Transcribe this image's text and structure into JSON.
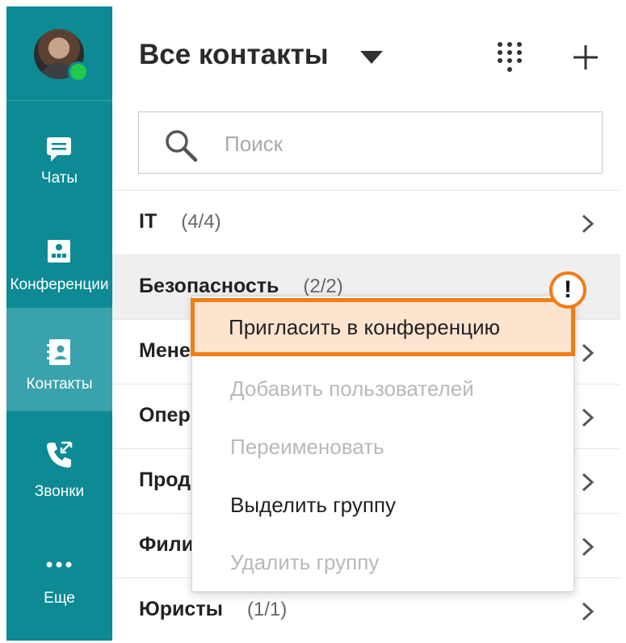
{
  "sidebar": {
    "user_status": "online",
    "items": [
      {
        "id": "chats",
        "label": "Чаты",
        "icon": "chat-icon"
      },
      {
        "id": "conferences",
        "label": "Конференции",
        "icon": "conference-icon"
      },
      {
        "id": "contacts",
        "label": "Контакты",
        "icon": "contacts-icon",
        "active": true
      },
      {
        "id": "calls",
        "label": "Звонки",
        "icon": "calls-icon"
      },
      {
        "id": "more",
        "label": "Еще",
        "icon": "more-icon"
      }
    ]
  },
  "header": {
    "title": "Все контакты",
    "dialpad_icon": "dialpad-icon",
    "add_icon": "plus-icon"
  },
  "search": {
    "placeholder": "Поиск",
    "value": ""
  },
  "groups": [
    {
      "name": "IT",
      "count": "(4/4)"
    },
    {
      "name": "Безопасность",
      "count": "(2/2)"
    },
    {
      "name": "Мене",
      "count": ""
    },
    {
      "name": "Опер",
      "count": ""
    },
    {
      "name": "Прод",
      "count": ""
    },
    {
      "name": "Фили",
      "count": ""
    },
    {
      "name": "Юристы",
      "count": "(1/1)"
    }
  ],
  "context_menu": {
    "items": [
      {
        "label": "Пригласить в конференцию",
        "state": "highlighted"
      },
      {
        "label": "Добавить пользователей",
        "state": "disabled"
      },
      {
        "label": "Переименовать",
        "state": "disabled"
      },
      {
        "label": "Выделить группу",
        "state": "enabled"
      },
      {
        "label": "Удалить группу",
        "state": "disabled"
      }
    ]
  },
  "alert_badge": "!",
  "colors": {
    "sidebar": "#0d8a94",
    "sidebar_active": "#3aa2ac",
    "highlight_border": "#f07d17",
    "highlight_fill": "#fde4cf",
    "online": "#22c94a"
  }
}
